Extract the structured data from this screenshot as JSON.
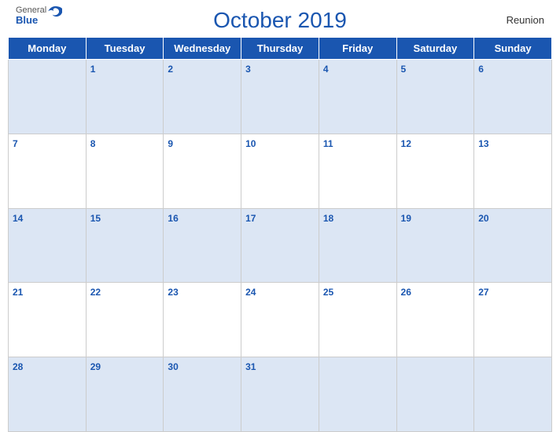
{
  "header": {
    "title": "October 2019",
    "region": "Reunion",
    "logo": {
      "general": "General",
      "blue": "Blue"
    }
  },
  "days_of_week": [
    "Monday",
    "Tuesday",
    "Wednesday",
    "Thursday",
    "Friday",
    "Saturday",
    "Sunday"
  ],
  "weeks": [
    [
      null,
      1,
      2,
      3,
      4,
      5,
      6
    ],
    [
      7,
      8,
      9,
      10,
      11,
      12,
      13
    ],
    [
      14,
      15,
      16,
      17,
      18,
      19,
      20
    ],
    [
      21,
      22,
      23,
      24,
      25,
      26,
      27
    ],
    [
      28,
      29,
      30,
      31,
      null,
      null,
      null
    ]
  ]
}
